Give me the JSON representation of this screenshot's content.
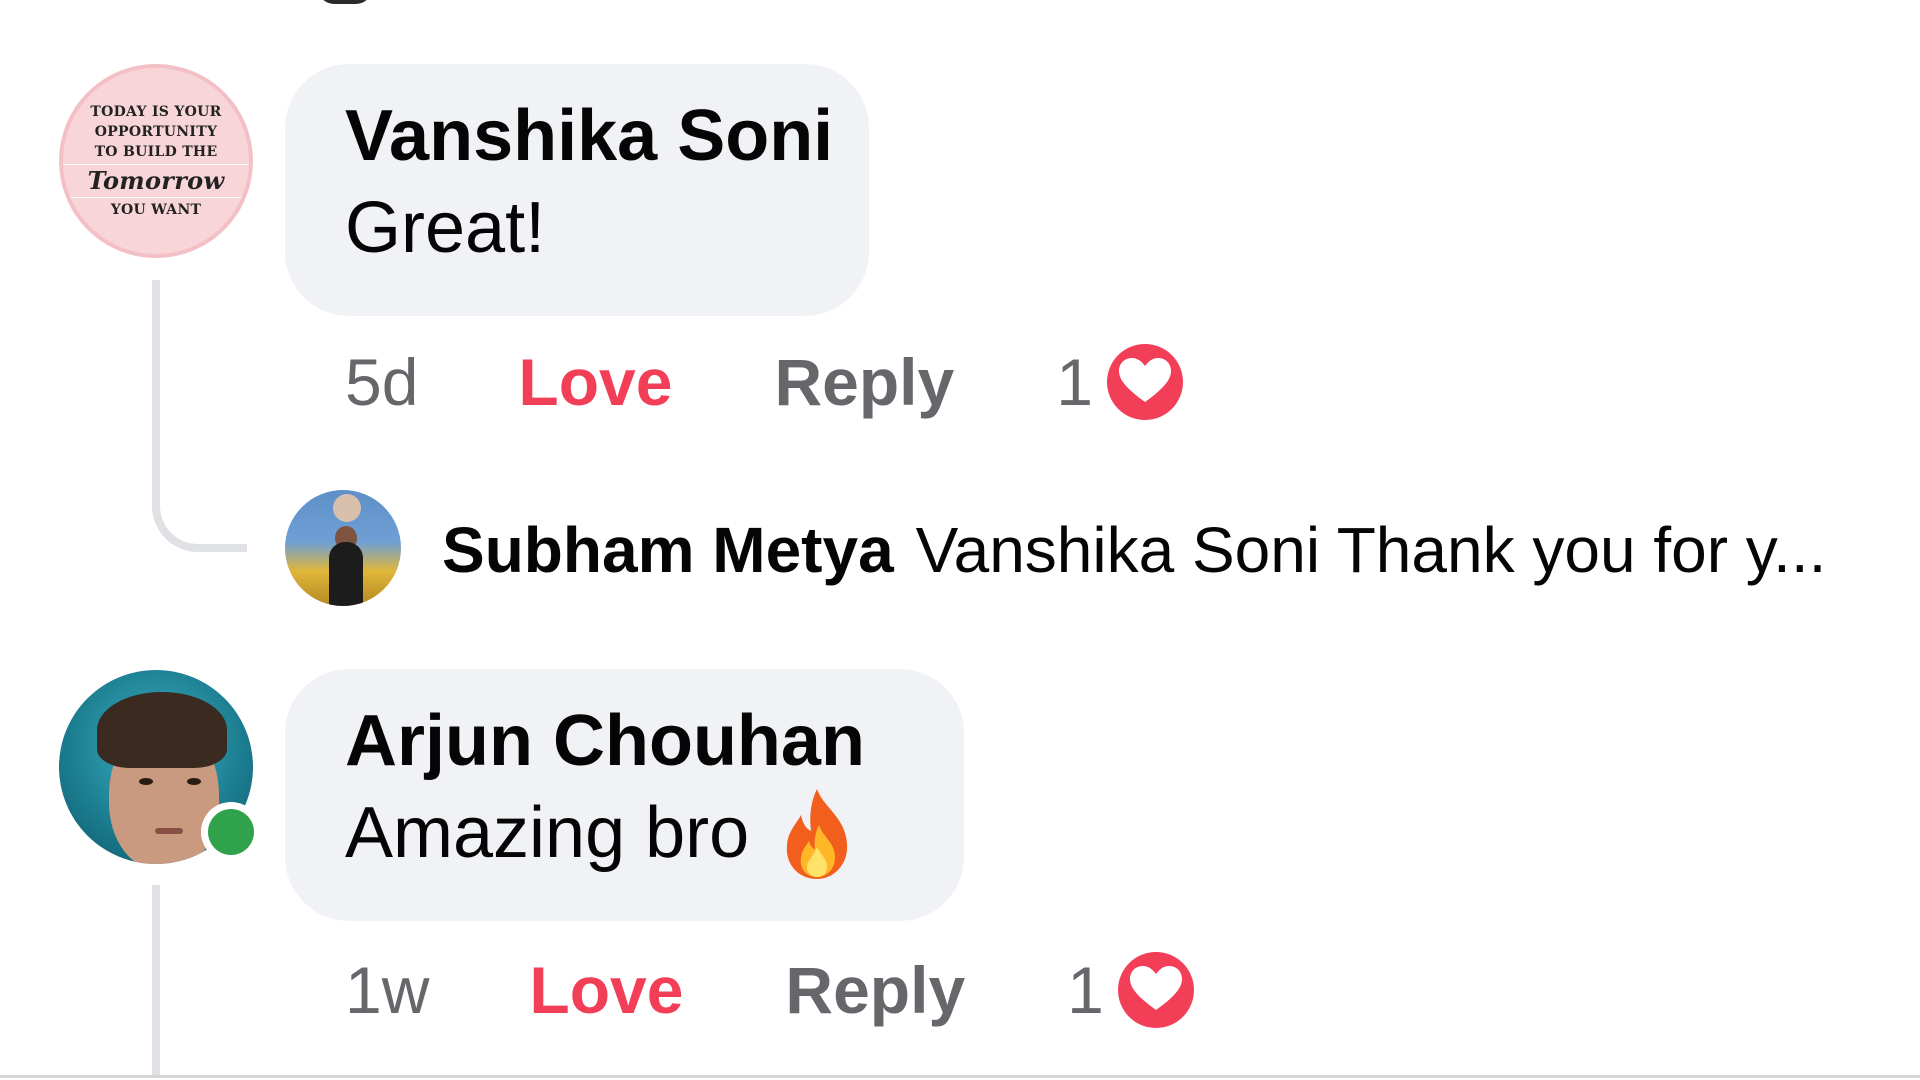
{
  "comments": [
    {
      "author": "Vanshika Soni",
      "text": "Great!",
      "time": "5d",
      "love_label": "Love",
      "reply_label": "Reply",
      "reaction_count": "1",
      "reaction_icon": "heart-icon",
      "avatar_quote": {
        "line1": "TODAY IS YOUR",
        "line2": "OPPORTUNITY",
        "line3": "TO BUILD THE",
        "line4": "Tomorrow",
        "line5": "YOU WANT"
      },
      "reply_preview": {
        "author": "Subham Metya",
        "text": "Vanshika Soni Thank you for y..."
      }
    },
    {
      "author": "Arjun Chouhan",
      "text": "Amazing bro",
      "emoji_icon": "fire-icon",
      "time": "1w",
      "love_label": "Love",
      "reply_label": "Reply",
      "reaction_count": "1",
      "reaction_icon": "heart-icon",
      "online": true
    }
  ],
  "colors": {
    "bubble_bg": "#f0f2f5",
    "love_active": "#f33e58",
    "secondary_text": "#65676b",
    "online_green": "#31a24c",
    "thread_line": "#dfe1e4"
  }
}
